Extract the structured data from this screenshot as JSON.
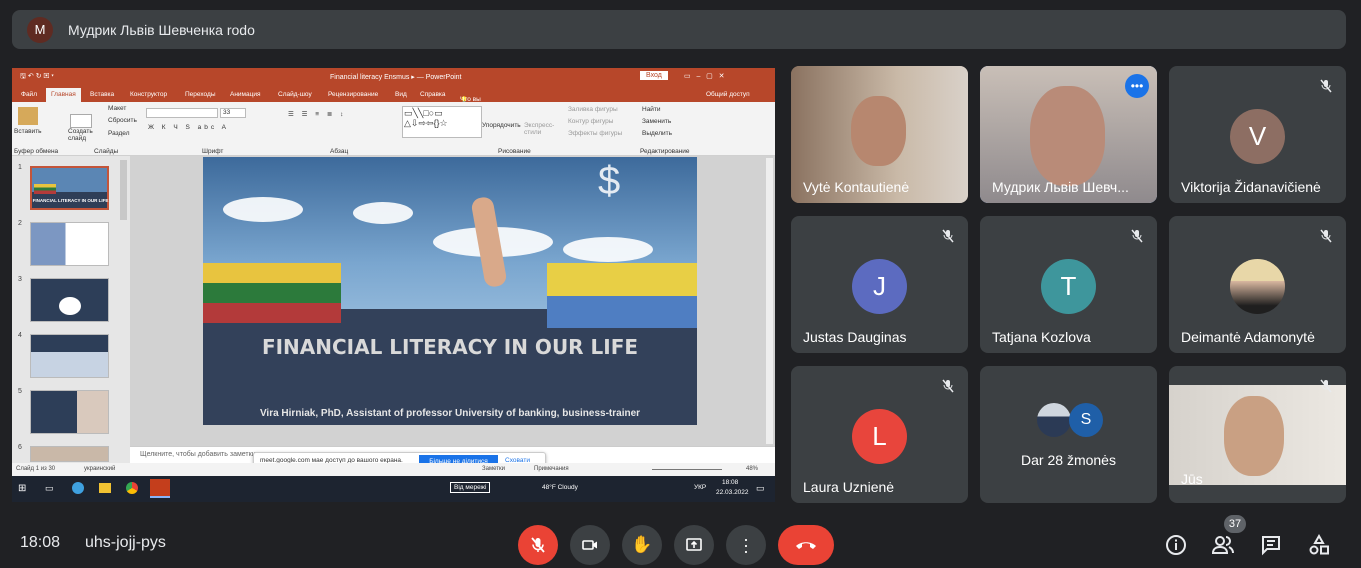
{
  "banner": {
    "avatar_letter": "M",
    "presenter_text": "Мудрик Львів Шевченка rodo"
  },
  "powerpoint": {
    "window_title": "Financial literacy Ensmus ▸ — PowerPoint",
    "signin": "Вход",
    "tabs": [
      "Файл",
      "Главная",
      "Вставка",
      "Конструктор",
      "Переходы",
      "Анимация",
      "Слайд-шоу",
      "Рецензирование",
      "Вид",
      "Справка",
      "Что вы хотите сделать?",
      "Общий доступ"
    ],
    "ribbon": {
      "paste": "Вставить",
      "create_slide": "Создать слайд",
      "layout": "Макет",
      "reset": "Сбросить",
      "section": "Раздел",
      "clipboard": "Буфер обмена",
      "slides": "Слайды",
      "font": "Шрифт",
      "paragraph": "Абзац",
      "drawing": "Рисование",
      "editing": "Редактирование",
      "arrange": "Упорядочить",
      "express_styles": "Экспресс-стили",
      "fill": "Заливка фигуры",
      "outline": "Контур фигуры",
      "effects": "Эффекты фигуры",
      "find": "Найти",
      "replace": "Заменить",
      "select": "Выделить",
      "font_size": "33"
    },
    "slide_numbers": [
      "1",
      "2",
      "3",
      "4",
      "5",
      "6"
    ],
    "slide": {
      "title": "FINANCIAL LITERACY IN OUR LIFE",
      "subtitle": "Vira Hirniak, PhD, Assistant of professor University of banking, business-trainer",
      "flag_lt": [
        "#e8c43f",
        "#2c7a3b",
        "#b33a3a"
      ],
      "flag_ua": [
        "#e8cf45",
        "#4f7ec2"
      ]
    },
    "thumb1_title": "FINANCIAL LITERACY IN OUR LIFE",
    "notes": "Щелкните, чтобы добавить заметки",
    "status": {
      "slide": "Слайд 1 из 30",
      "lang": "украинский",
      "notes": "Заметки",
      "comments": "Примечания",
      "zoom": "48%"
    },
    "sharing_bar": {
      "text": "meet.google.com мае доступ до вашого екрана.",
      "stop": "Більше не ділитися",
      "hide": "Сховати"
    },
    "taskbar": {
      "network": "Від мережі",
      "weather": "48°F Cloudy",
      "lang": "УКР",
      "time": "18:08",
      "date": "22.03.2022"
    }
  },
  "participants": [
    {
      "name": "Vytė Kontautienė",
      "type": "video"
    },
    {
      "name": "Мудрик Львів Шевч...",
      "type": "video",
      "speaking": true
    },
    {
      "name": "Viktorija Židanavičienė",
      "letter": "V",
      "color": "#8d6e63",
      "muted": true
    },
    {
      "name": "Justas Dauginas",
      "letter": "J",
      "color": "#5c6bc0",
      "muted": true
    },
    {
      "name": "Tatjana Kozlova",
      "letter": "T",
      "color": "#3e969c",
      "muted": true
    },
    {
      "name": "Deimantė Adamonytė",
      "type": "avatar",
      "muted": true
    },
    {
      "name": "Laura Uznienė",
      "letter": "L",
      "color": "#e8453c",
      "muted": true
    },
    {
      "name": "Dar 28 žmonės",
      "letter": "S",
      "color": "#1f5fa8"
    },
    {
      "name": "Jūs",
      "type": "video",
      "muted": true
    }
  ],
  "bottom": {
    "time": "18:08",
    "meeting_code": "uhs-jojj-pys",
    "people_count": "37"
  },
  "colors": {
    "bg": "#202124",
    "tile": "#3c4043",
    "danger": "#ea4335",
    "accent": "#8ab4f8"
  }
}
